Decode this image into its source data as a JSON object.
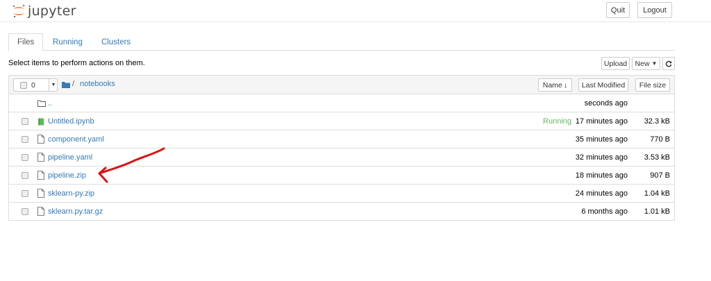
{
  "header": {
    "logo_text": "jupyter",
    "quit_label": "Quit",
    "logout_label": "Logout"
  },
  "tabs": [
    {
      "label": "Files",
      "active": true
    },
    {
      "label": "Running",
      "active": false
    },
    {
      "label": "Clusters",
      "active": false
    }
  ],
  "toolbar": {
    "instructions": "Select items to perform actions on them.",
    "upload_label": "Upload",
    "new_label": "New",
    "refresh_icon": "refresh-icon"
  },
  "list_header": {
    "selected_count": "0",
    "path_separator": "/",
    "breadcrumb": "notebooks",
    "name_label": "Name",
    "last_modified_label": "Last Modified",
    "file_size_label": "File size"
  },
  "rows": [
    {
      "name": "..",
      "type": "folder",
      "modified": "seconds ago",
      "size": "",
      "status": ""
    },
    {
      "name": "Untitled.ipynb",
      "type": "notebook",
      "modified": "17 minutes ago",
      "size": "32.3 kB",
      "status": "Running"
    },
    {
      "name": "component.yaml",
      "type": "file",
      "modified": "35 minutes ago",
      "size": "770 B",
      "status": ""
    },
    {
      "name": "pipeline.yaml",
      "type": "file",
      "modified": "32 minutes ago",
      "size": "3.53 kB",
      "status": ""
    },
    {
      "name": "pipeline.zip",
      "type": "file",
      "modified": "18 minutes ago",
      "size": "907 B",
      "status": ""
    },
    {
      "name": "sklearn-py.zip",
      "type": "file",
      "modified": "24 minutes ago",
      "size": "1.04 kB",
      "status": ""
    },
    {
      "name": "sklearn.py.tar.gz",
      "type": "file",
      "modified": "6 months ago",
      "size": "1.01 kB",
      "status": ""
    }
  ],
  "colors": {
    "link": "#337ab7",
    "running": "#5cb85c",
    "logo_orange": "#f37726",
    "annotation": "#e01010"
  }
}
